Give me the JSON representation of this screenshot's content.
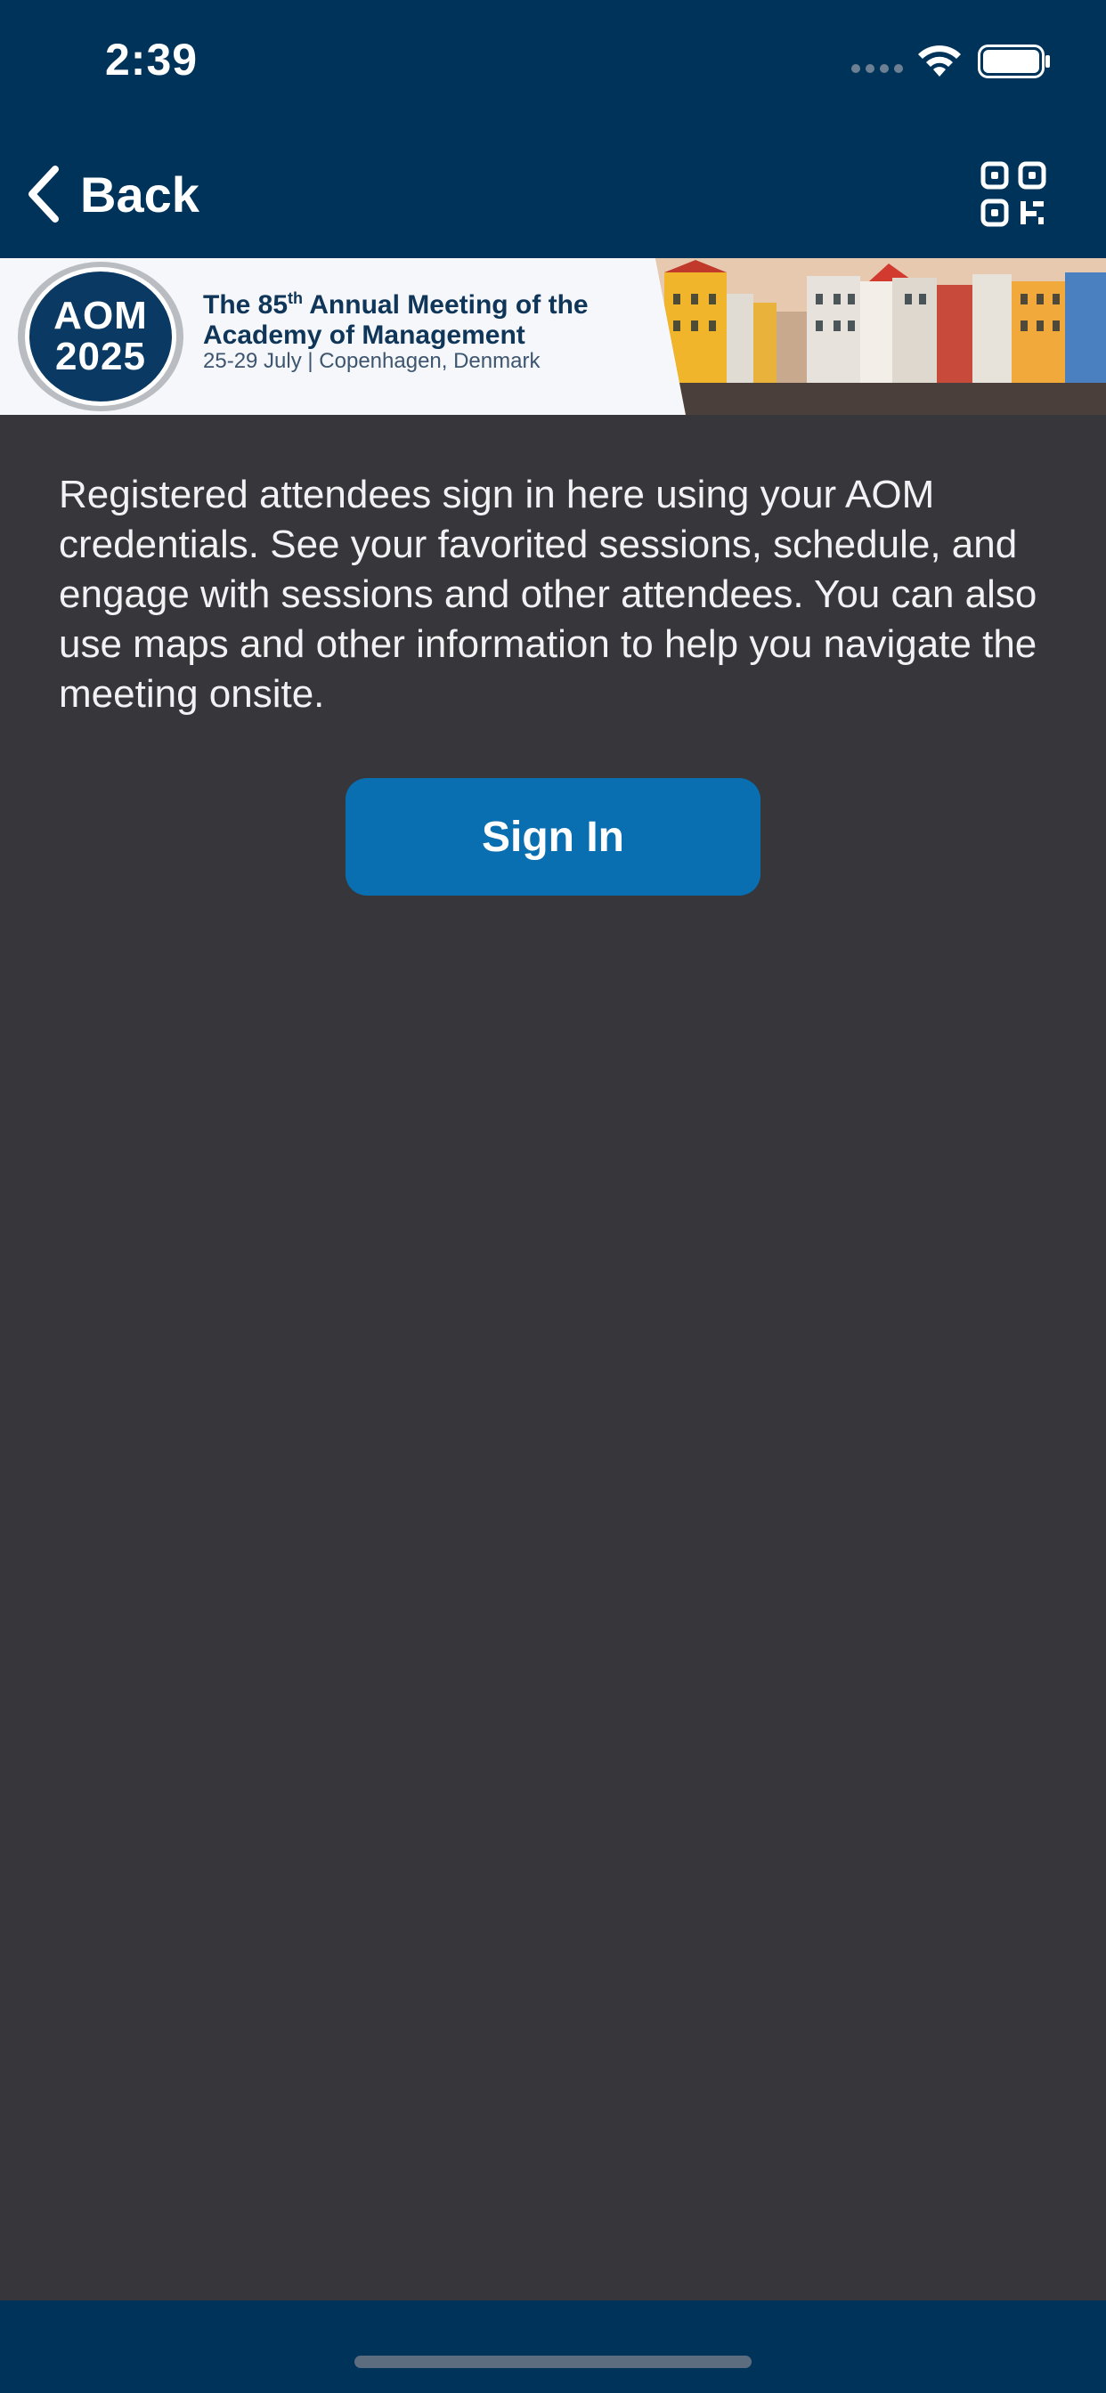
{
  "status_bar": {
    "time": "2:39"
  },
  "nav": {
    "back_label": "Back",
    "qr_icon": "qr-code-icon"
  },
  "banner": {
    "logo_line1": "AOM",
    "logo_line2": "2025",
    "title_prefix": "The 85",
    "title_sup": "th",
    "title_rest": " Annual Meeting of the Academy of Management",
    "subtitle": "25-29 July | Copenhagen, Denmark"
  },
  "content": {
    "intro_text": "Registered attendees sign in here using your AOM credentials. See your favorited sessions, schedule, and engage with sessions and other attendees. You can also use maps and other information to help you navigate the meeting onsite.",
    "signin_label": "Sign In"
  },
  "colors": {
    "header_bg": "#00335a",
    "page_bg": "#36363b",
    "button_bg": "#0a6fb0"
  }
}
